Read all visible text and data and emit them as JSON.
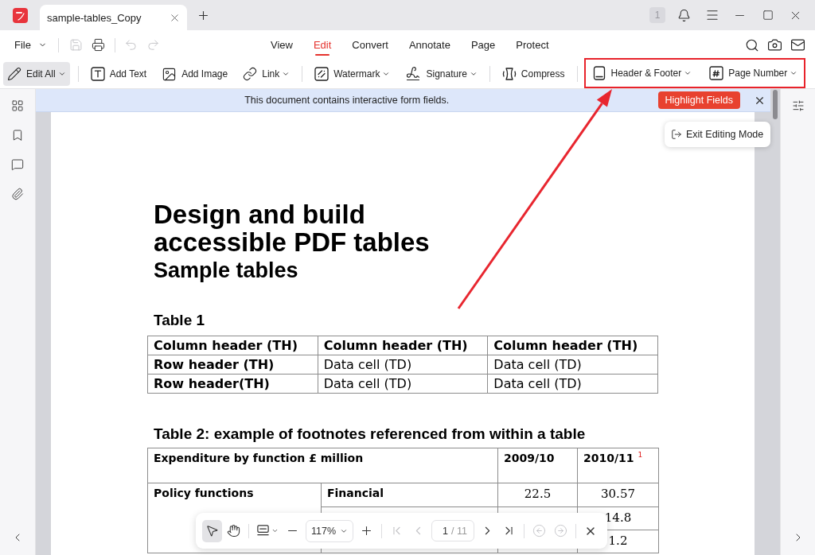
{
  "title_bar": {
    "document_tab": {
      "title": "sample-tables_Copy"
    },
    "notification_count": "1"
  },
  "menu_bar": {
    "file_menu": {
      "label": "File"
    },
    "quick_action_groups": [
      [
        {
          "disabled": true
        },
        {
          "disabled": false
        }
      ],
      [
        {
          "disabled": true
        },
        {
          "disabled": true
        }
      ]
    ],
    "tabs": [
      {
        "label": "View",
        "selected": false
      },
      {
        "label": "Edit",
        "selected": true
      },
      {
        "label": "Convert",
        "selected": false
      },
      {
        "label": "Annotate",
        "selected": false
      },
      {
        "label": "Page",
        "selected": false
      },
      {
        "label": "Protect",
        "selected": false
      }
    ]
  },
  "toolbar": {
    "groups": [
      {
        "highlighted": false,
        "tools": [
          {
            "label": "Edit All",
            "selected": true,
            "dropdown": true
          }
        ]
      },
      {
        "highlighted": false,
        "tools": [
          {
            "label": "Add Text",
            "selected": false,
            "dropdown": false
          },
          {
            "label": "Add Image",
            "selected": false,
            "dropdown": false
          },
          {
            "label": "Link",
            "selected": false,
            "dropdown": true
          }
        ]
      },
      {
        "highlighted": false,
        "tools": [
          {
            "label": "Watermark",
            "selected": false,
            "dropdown": true
          },
          {
            "label": "Signature",
            "selected": false,
            "dropdown": true
          }
        ]
      },
      {
        "highlighted": false,
        "tools": [
          {
            "label": "Compress",
            "selected": false,
            "dropdown": false
          }
        ]
      },
      {
        "highlighted": true,
        "tools": [
          {
            "label": "Header & Footer",
            "selected": false,
            "dropdown": true
          },
          {
            "label": "Page Number",
            "selected": false,
            "dropdown": true
          }
        ]
      }
    ]
  },
  "info_bar": {
    "message": "This document contains interactive form fields.",
    "action": "Highlight Fields"
  },
  "editing_popup": {
    "label": "Exit Editing Mode"
  },
  "document": {
    "title": "Design and build accessible PDF tables",
    "subtitle": "Sample tables",
    "table_1": {
      "caption": "Table 1",
      "columns": [
        "Column header (TH)",
        "Column header (TH)",
        "Column header (TH)"
      ],
      "rows": [
        [
          "Row header (TH)",
          "Data cell (TD)",
          "Data cell (TD)"
        ],
        [
          "Row header(TH)",
          "Data cell (TD)",
          "Data cell (TD)"
        ]
      ]
    },
    "table_2": {
      "caption": "Table 2: example of footnotes referenced from within a table",
      "header": {
        "label": "Expenditure by function £ million",
        "years": [
          "2009/10",
          "2010/11 $^{1}$"
        ]
      },
      "group": "Policy functions",
      "rows": [
        {
          "category": "Financial",
          "value_2009_10": "22.5",
          "value_2010_11": "30.57"
        },
        {
          "value_2010_11": "14.8"
        },
        {
          "value_2010_11": "1.2"
        }
      ]
    }
  },
  "page_toolbar": {
    "tools": [
      {
        "selected": true
      },
      {
        "selected": false
      }
    ],
    "zoom": "117%",
    "page_input": "1",
    "page_total": "/ 11",
    "page_nav": [
      {
        "disabled": true
      },
      {
        "disabled": true
      },
      {
        "disabled": false
      },
      {
        "disabled": false
      }
    ],
    "history": [
      {
        "disabled": true
      },
      {
        "disabled": true
      }
    ]
  }
}
